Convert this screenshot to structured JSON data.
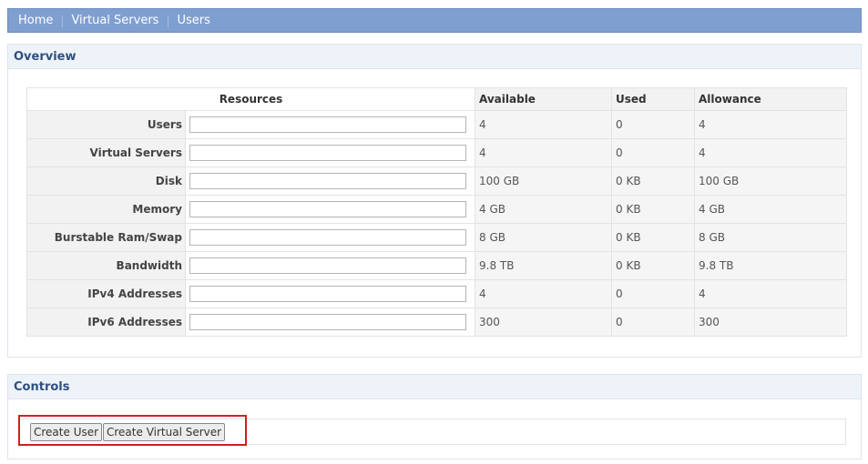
{
  "breadcrumb": {
    "items": [
      "Home",
      "Virtual Servers",
      "Users"
    ],
    "separator": "|"
  },
  "overview": {
    "title": "Overview",
    "columns": {
      "resources": "Resources",
      "available": "Available",
      "used": "Used",
      "allowance": "Allowance"
    },
    "rows": [
      {
        "label": "Users",
        "available": "4",
        "used": "0",
        "allowance": "4",
        "usage_fraction": 0
      },
      {
        "label": "Virtual Servers",
        "available": "4",
        "used": "0",
        "allowance": "4",
        "usage_fraction": 0
      },
      {
        "label": "Disk",
        "available": "100 GB",
        "used": "0 KB",
        "allowance": "100 GB",
        "usage_fraction": 0
      },
      {
        "label": "Memory",
        "available": "4 GB",
        "used": "0 KB",
        "allowance": "4 GB",
        "usage_fraction": 0
      },
      {
        "label": "Burstable Ram/Swap",
        "available": "8 GB",
        "used": "0 KB",
        "allowance": "8 GB",
        "usage_fraction": 0
      },
      {
        "label": "Bandwidth",
        "available": "9.8 TB",
        "used": "0 KB",
        "allowance": "9.8 TB",
        "usage_fraction": 0
      },
      {
        "label": "IPv4 Addresses",
        "available": "4",
        "used": "0",
        "allowance": "4",
        "usage_fraction": 0
      },
      {
        "label": "IPv6 Addresses",
        "available": "300",
        "used": "0",
        "allowance": "300",
        "usage_fraction": 0
      }
    ]
  },
  "controls": {
    "title": "Controls",
    "create_user_label": "Create User",
    "create_vs_label": "Create Virtual Server"
  },
  "colors": {
    "nav_bar": "#7f9fd0",
    "panel_header": "#eef3fa",
    "highlight": "#d01f1f"
  }
}
